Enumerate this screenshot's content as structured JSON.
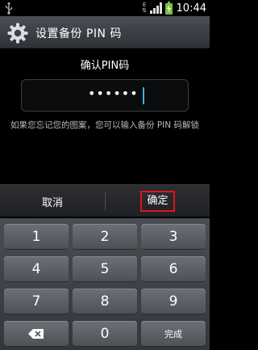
{
  "status": {
    "network": "E",
    "time": "10:44"
  },
  "title": "设置备份 PIN 码",
  "prompt": "确认PIN码",
  "pin": {
    "value": "••••••"
  },
  "hint": "如果您忘记您的图案，您可以输入备份 PIN 码解锁",
  "buttons": {
    "cancel": "取消",
    "ok": "确定"
  },
  "keys": {
    "k1": "1",
    "k2": "2",
    "k3": "3",
    "k4": "4",
    "k5": "5",
    "k6": "6",
    "k7": "7",
    "k8": "8",
    "k9": "9",
    "k0": "0",
    "done": "完成"
  },
  "icons": {
    "usb": "usb-icon",
    "signal": "signal-icon",
    "battery": "battery-charging-icon",
    "settings": "gear-icon",
    "backspace": "backspace-icon"
  },
  "colors": {
    "accent": "#33b5e5",
    "highlight": "#e0141e",
    "battery": "#76c043"
  }
}
